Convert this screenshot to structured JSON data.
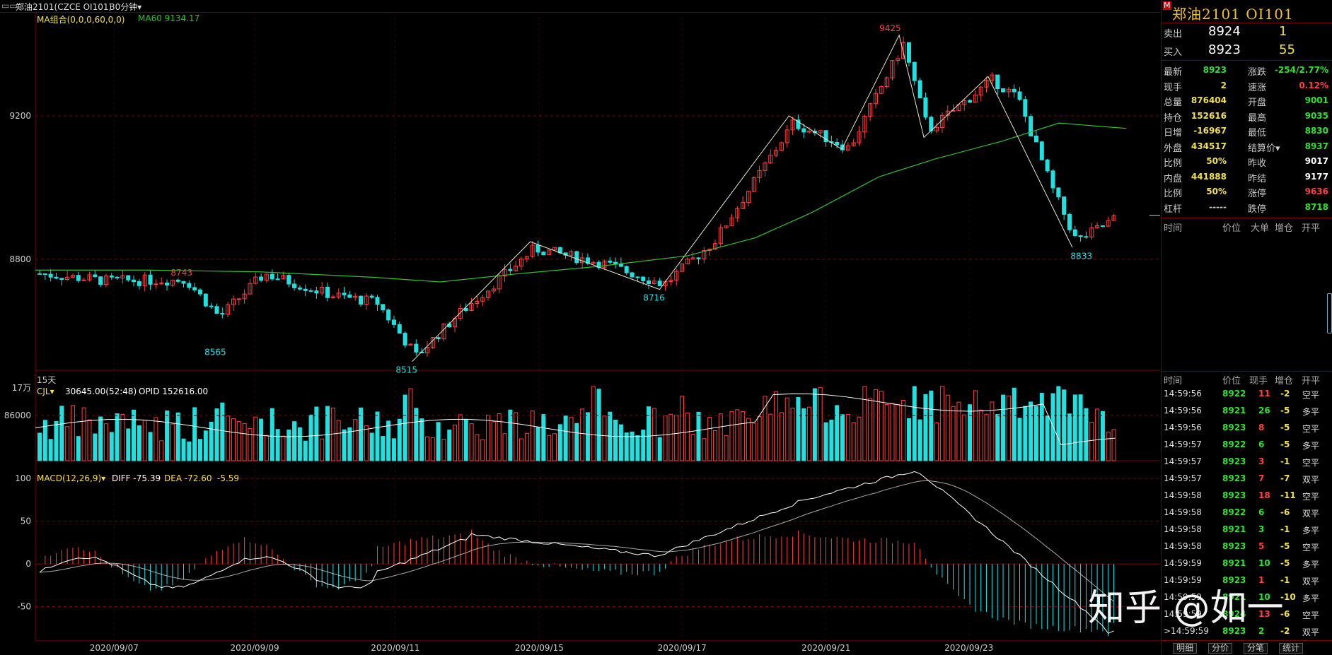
{
  "titlebar": {
    "icon": "window-icon",
    "symbol_label": "郑油2101(CZCE OI101)",
    "period_label": "30分钟▾"
  },
  "legends": {
    "ma_label": "MA组合(0,0,0,60,0,0)",
    "ma60_label": "MA60 9134.17",
    "cjl_label": "CJL▾",
    "cjl_value": "30645.00(52:48)",
    "opid_value": "OPID 152616.00",
    "macd_label": "MACD(12,26,9)▾",
    "diff_value": "DIFF -75.39",
    "dea_value": "DEA -72.60",
    "macd_value": "-5.59",
    "period_days": "15天"
  },
  "colors": {
    "up": "#ff4040",
    "down": "#20e0e0",
    "ma60": "#30c030",
    "zigzag": "#e8e8c8",
    "diff": "#ffffff",
    "dea": "#e0e0e0",
    "grid": "#7a0000",
    "axis_text": "#cccccc"
  },
  "chart_data": [
    {
      "type": "candlestick",
      "title": "郑油2101",
      "y_ticks": [
        9200,
        8800
      ],
      "x_labels": [
        "2020/09/07",
        "2020/09/09",
        "2020/09/11",
        "2020/09/15",
        "2020/09/17",
        "2020/09/21",
        "2020/09/23"
      ],
      "series_names": [
        "MA60"
      ],
      "annotations": [
        {
          "label": "8743",
          "x_frac": 0.13,
          "value": 8743
        },
        {
          "label": "8565",
          "x_frac": 0.16,
          "value": 8565
        },
        {
          "label": "8515",
          "x_frac": 0.33,
          "value": 8515
        },
        {
          "label": "8716",
          "x_frac": 0.55,
          "value": 8716
        },
        {
          "label": "9425",
          "x_frac": 0.76,
          "value": 9425
        },
        {
          "label": "8833",
          "x_frac": 0.93,
          "value": 8833
        }
      ],
      "zigzag_points": [
        [
          0.335,
          8515
        ],
        [
          0.44,
          8849
        ],
        [
          0.555,
          8716
        ],
        [
          0.67,
          9200
        ],
        [
          0.717,
          9107
        ],
        [
          0.768,
          9425
        ],
        [
          0.79,
          9140
        ],
        [
          0.847,
          9310
        ],
        [
          0.922,
          8833
        ]
      ],
      "ma60_points": [
        [
          0,
          8770
        ],
        [
          0.1,
          8770
        ],
        [
          0.2,
          8765
        ],
        [
          0.3,
          8750
        ],
        [
          0.36,
          8737
        ],
        [
          0.43,
          8760
        ],
        [
          0.5,
          8780
        ],
        [
          0.58,
          8810
        ],
        [
          0.64,
          8860
        ],
        [
          0.69,
          8930
        ],
        [
          0.75,
          9030
        ],
        [
          0.8,
          9080
        ],
        [
          0.86,
          9130
        ],
        [
          0.91,
          9180
        ],
        [
          0.97,
          9165
        ]
      ]
    },
    {
      "type": "bar",
      "title": "CJL",
      "y_ticks": [
        "17万",
        "86000"
      ],
      "max": 170000
    },
    {
      "type": "bar",
      "title": "MACD",
      "y_ticks": [
        100,
        50,
        0,
        -50
      ],
      "ylim": [
        -90,
        110
      ]
    }
  ],
  "quote": {
    "code_title": "郑油2101  OI101",
    "code_badge": "M",
    "sell": {
      "label": "卖出",
      "price": "8924",
      "qty": "1"
    },
    "buy": {
      "label": "买入",
      "price": "8923",
      "qty": "55"
    },
    "left": [
      {
        "label": "最新",
        "value": "8923",
        "color": "#30e030"
      },
      {
        "label": "现手",
        "value": "2",
        "color": "#f0e050"
      },
      {
        "label": "总量",
        "value": "876404",
        "color": "#f0e050"
      },
      {
        "label": "持仓",
        "value": "152616",
        "color": "#f0e050"
      },
      {
        "label": "日增",
        "value": "-16967",
        "color": "#f0e050"
      },
      {
        "label": "外盘",
        "value": "434517",
        "color": "#f0e050"
      },
      {
        "label": "比例",
        "value": "50%",
        "color": "#f0e050"
      },
      {
        "label": "内盘",
        "value": "441888",
        "color": "#f0e050"
      },
      {
        "label": "比例",
        "value": "50%",
        "color": "#f0e050"
      },
      {
        "label": "杠杆",
        "value": "-----",
        "color": "#cccccc"
      }
    ],
    "right": [
      {
        "label": "涨跌",
        "value": "-254/2.77%",
        "color": "#30e030"
      },
      {
        "label": "速涨",
        "value": "0.12%",
        "color": "#ff4040"
      },
      {
        "label": "开盘",
        "value": "9001",
        "color": "#30e030"
      },
      {
        "label": "最高",
        "value": "9035",
        "color": "#30e030"
      },
      {
        "label": "最低",
        "value": "8830",
        "color": "#30e030"
      },
      {
        "label": "结算价▾",
        "value": "8937",
        "color": "#30e030"
      },
      {
        "label": "昨收",
        "value": "9017",
        "color": "#ffffff"
      },
      {
        "label": "昨结",
        "value": "9177",
        "color": "#ffffff"
      },
      {
        "label": "涨停",
        "value": "9636",
        "color": "#ff4040"
      },
      {
        "label": "跌停",
        "value": "8718",
        "color": "#30e030"
      }
    ],
    "bigorder_header": [
      "时间",
      "价位",
      "大单",
      "增仓",
      "开平"
    ],
    "tick_header": [
      "时间",
      "价位",
      "现手",
      "增仓",
      "开平"
    ],
    "ticks": [
      {
        "time": "14:59:56",
        "price": "8922",
        "vol": "11",
        "vol_color": "#ff4040",
        "chg": "-2",
        "type": "空平"
      },
      {
        "time": "14:59:56",
        "price": "8921",
        "vol": "26",
        "vol_color": "#30e030",
        "chg": "-5",
        "type": "多平"
      },
      {
        "time": "14:59:56",
        "price": "8923",
        "vol": "8",
        "vol_color": "#ff4040",
        "chg": "-5",
        "type": "空平"
      },
      {
        "time": "14:59:57",
        "price": "8922",
        "vol": "6",
        "vol_color": "#30e030",
        "chg": "-5",
        "type": "多平"
      },
      {
        "time": "14:59:57",
        "price": "8923",
        "vol": "3",
        "vol_color": "#ff4040",
        "chg": "-1",
        "type": "空平"
      },
      {
        "time": "14:59:57",
        "price": "8923",
        "vol": "7",
        "vol_color": "#ff4040",
        "chg": "-7",
        "type": "双平"
      },
      {
        "time": "14:59:58",
        "price": "8923",
        "vol": "18",
        "vol_color": "#ff4040",
        "chg": "-11",
        "type": "空平"
      },
      {
        "time": "14:59:58",
        "price": "8922",
        "vol": "6",
        "vol_color": "#30e030",
        "chg": "-6",
        "type": "双平"
      },
      {
        "time": "14:59:58",
        "price": "8921",
        "vol": "3",
        "vol_color": "#30e030",
        "chg": "-1",
        "type": "多平"
      },
      {
        "time": "14:59:58",
        "price": "8923",
        "vol": "5",
        "vol_color": "#ff4040",
        "chg": "-5",
        "type": "空平"
      },
      {
        "time": "14:59:59",
        "price": "8921",
        "vol": "10",
        "vol_color": "#30e030",
        "chg": "-5",
        "type": "多平"
      },
      {
        "time": "14:59:59",
        "price": "8923",
        "vol": "1",
        "vol_color": "#ff4040",
        "chg": "-1",
        "type": "双平"
      },
      {
        "time": "14:59:59",
        "price": "8921",
        "vol": "10",
        "vol_color": "#30e030",
        "chg": "-10",
        "type": "多平"
      },
      {
        "time": "14:59:59",
        "price": "8924",
        "vol": "13",
        "vol_color": "#ff4040",
        "chg": "-6",
        "type": "空平"
      },
      {
        "time": ">14:59:59",
        "price": "8923",
        "vol": "2",
        "vol_color": "#30e030",
        "chg": "-2",
        "type": "双平"
      }
    ],
    "tabs": [
      "明细",
      "分价",
      "分笔",
      "统计"
    ]
  },
  "watermark": "知乎 @如一"
}
